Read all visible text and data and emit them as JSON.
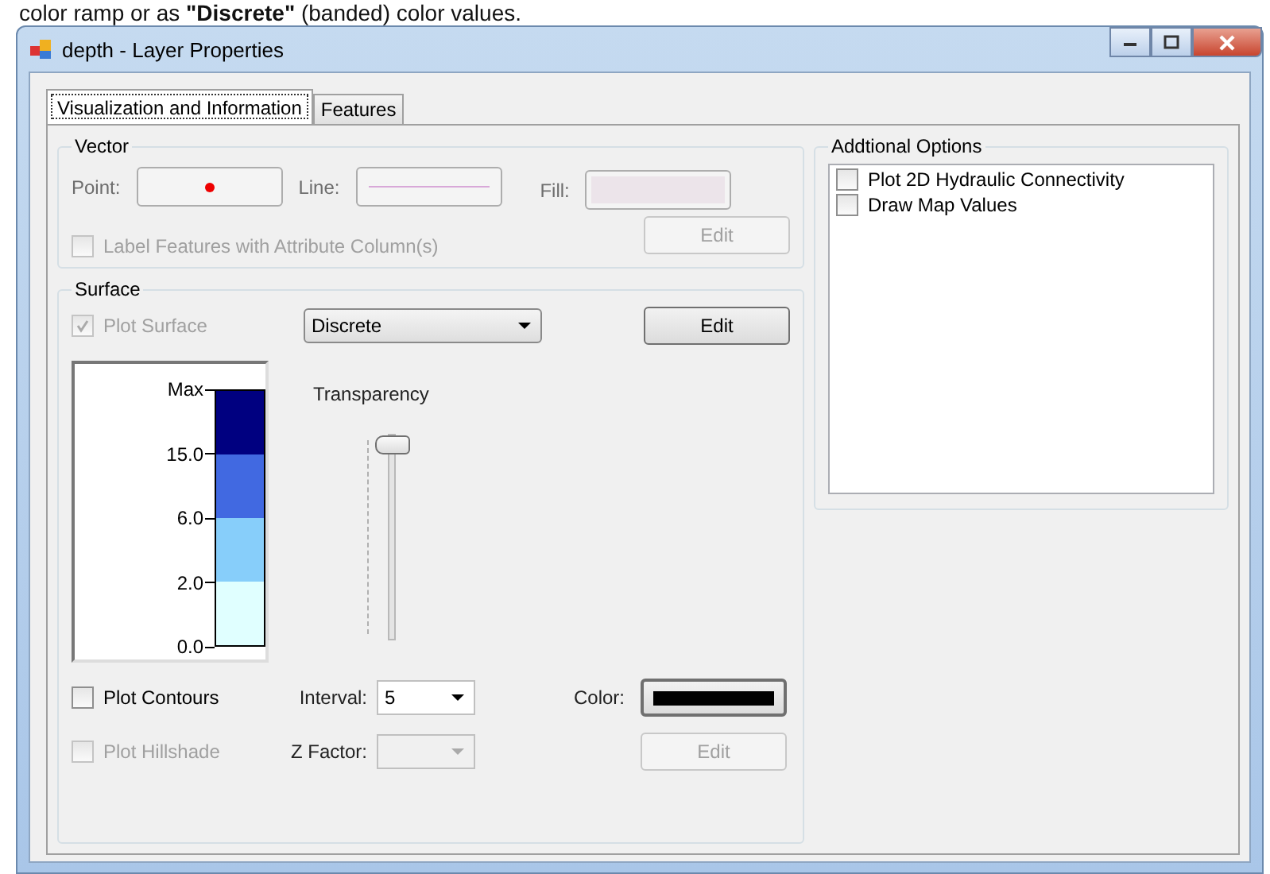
{
  "background_text": "color ramp or as **\"Discrete\"** (banded) color values.",
  "window": {
    "title": "depth - Layer Properties"
  },
  "tabs": [
    {
      "label": "Visualization and Information",
      "selected": true
    },
    {
      "label": "Features",
      "selected": false
    }
  ],
  "vector": {
    "title": "Vector",
    "point_label": "Point:",
    "line_label": "Line:",
    "fill_label": "Fill:",
    "edit_button": {
      "label": "Edit",
      "disabled": true
    },
    "label_features": {
      "label": "Label Features with Attribute Column(s)",
      "checked": false,
      "disabled": true
    }
  },
  "surface": {
    "title": "Surface",
    "plot_surface": {
      "label": "Plot Surface",
      "checked": true,
      "disabled": true
    },
    "mode": {
      "value": "Discrete"
    },
    "edit_button": {
      "label": "Edit",
      "disabled": false
    },
    "legend": {
      "ticks": [
        "Max",
        "15.0",
        "6.0",
        "2.0",
        "0.0"
      ],
      "bands": [
        {
          "color": "#000080"
        },
        {
          "color": "#4169e1"
        },
        {
          "color": "#87cefa"
        },
        {
          "color": "#e0ffff"
        }
      ]
    },
    "transparency": {
      "label": "Transparency",
      "level": 1
    },
    "plot_contours": {
      "label": "Plot Contours",
      "checked": false,
      "disabled": false
    },
    "interval": {
      "label": "Interval:",
      "value": "5"
    },
    "color_label": "Color:",
    "plot_hillshade": {
      "label": "Plot Hillshade",
      "checked": false,
      "disabled": true
    },
    "z_factor": {
      "label": "Z Factor:",
      "disabled": true
    },
    "hillshade_edit": {
      "label": "Edit",
      "disabled": true
    }
  },
  "additional_options": {
    "title": "Addtional Options",
    "items": [
      {
        "label": "Plot 2D Hydraulic Connectivity",
        "checked": false
      },
      {
        "label": "Draw Map Values",
        "checked": false
      }
    ]
  }
}
